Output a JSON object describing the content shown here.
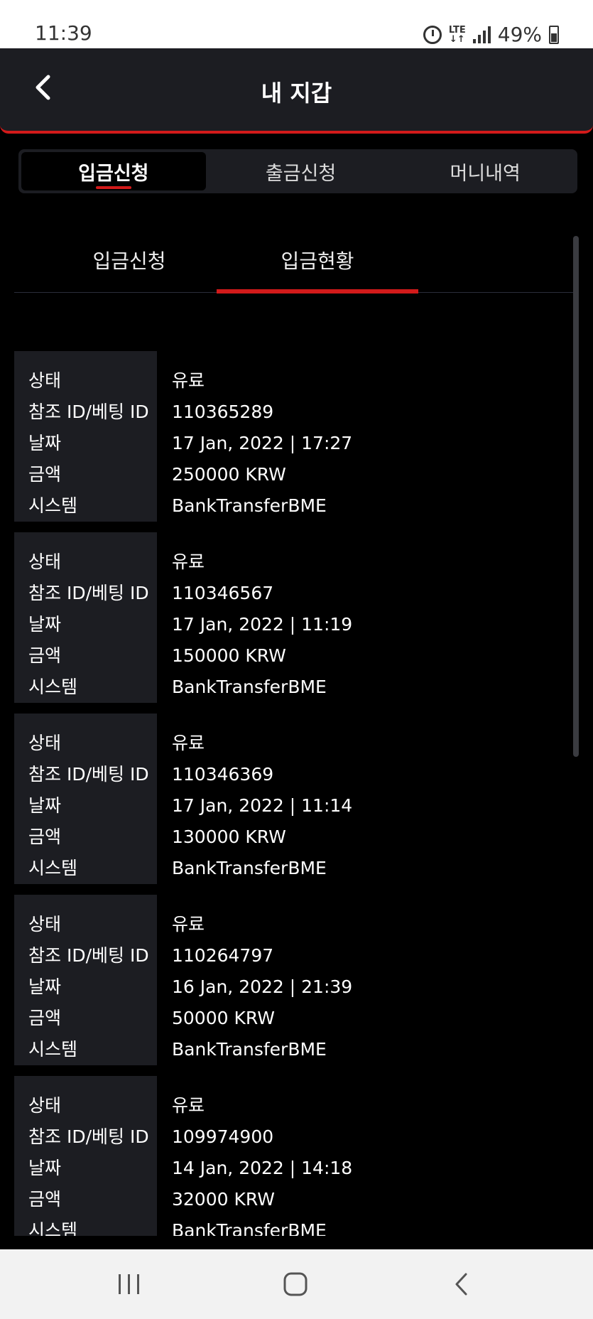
{
  "status_bar": {
    "time": "11:39",
    "network": "LTE",
    "battery": "49%"
  },
  "header": {
    "title": "내 지갑",
    "back_icon": "chevron-left-icon"
  },
  "main_tabs": [
    {
      "label": "입금신청",
      "active": true
    },
    {
      "label": "출금신청",
      "active": false
    },
    {
      "label": "머니내역",
      "active": false
    }
  ],
  "sub_tabs": [
    {
      "label": "입금신청",
      "active": false
    },
    {
      "label": "입금현황",
      "active": true
    }
  ],
  "field_labels": {
    "status": "상태",
    "ref_id": "참조 ID/베팅 ID",
    "date": "날짜",
    "amount": "금액",
    "system": "시스템"
  },
  "records": [
    {
      "status": "유료",
      "ref_id": "110365289",
      "date": "17 Jan, 2022 | 17:27",
      "amount": "250000 KRW",
      "system": "BankTransferBME"
    },
    {
      "status": "유료",
      "ref_id": "110346567",
      "date": "17 Jan, 2022 | 11:19",
      "amount": "150000 KRW",
      "system": "BankTransferBME"
    },
    {
      "status": "유료",
      "ref_id": "110346369",
      "date": "17 Jan, 2022 | 11:14",
      "amount": "130000 KRW",
      "system": "BankTransferBME"
    },
    {
      "status": "유료",
      "ref_id": "110264797",
      "date": "16 Jan, 2022 | 21:39",
      "amount": "50000 KRW",
      "system": "BankTransferBME"
    },
    {
      "status": "유료",
      "ref_id": "109974900",
      "date": "14 Jan, 2022 | 14:18",
      "amount": "32000 KRW",
      "system": "BankTransferBME"
    }
  ],
  "colors": {
    "accent": "#d21a1a",
    "panel": "#1c1d22",
    "background": "#000000"
  }
}
